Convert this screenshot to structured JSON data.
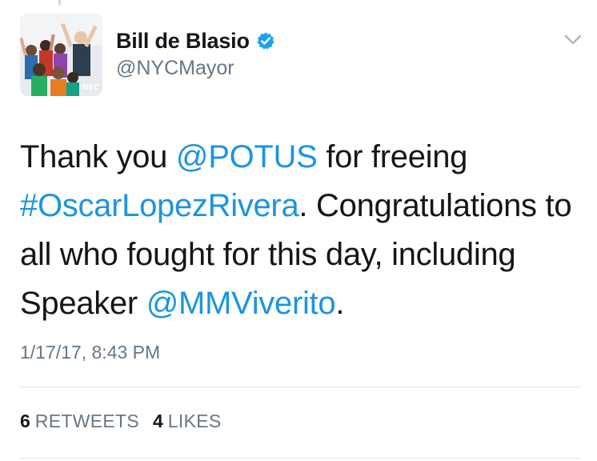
{
  "author": {
    "name": "Bill de Blasio",
    "handle": "@NYCMayor",
    "verified": true,
    "avatar_badge": "NYC",
    "verified_icon": "verified-badge-icon",
    "menu_icon": "chevron-down-icon"
  },
  "tweet": {
    "segments": [
      {
        "text": "Thank you ",
        "type": "text"
      },
      {
        "text": "@POTUS",
        "type": "mention"
      },
      {
        "text": " for freeing ",
        "type": "text"
      },
      {
        "text": "#OscarLopezRivera",
        "type": "hashtag"
      },
      {
        "text": ". Congratulations to all who fought for this day, including Speaker ",
        "type": "text"
      },
      {
        "text": "@MMViverito",
        "type": "mention"
      },
      {
        "text": ".",
        "type": "text"
      }
    ],
    "timestamp": "1/17/17, 8:43 PM"
  },
  "stats": {
    "retweets_count": "6",
    "retweets_label": "RETWEETS",
    "likes_count": "4",
    "likes_label": "LIKES"
  },
  "colors": {
    "link": "#1b95e0",
    "text": "#14171a",
    "muted": "#657786",
    "divider": "#e1e8ed",
    "verified": "#1da1f2"
  }
}
